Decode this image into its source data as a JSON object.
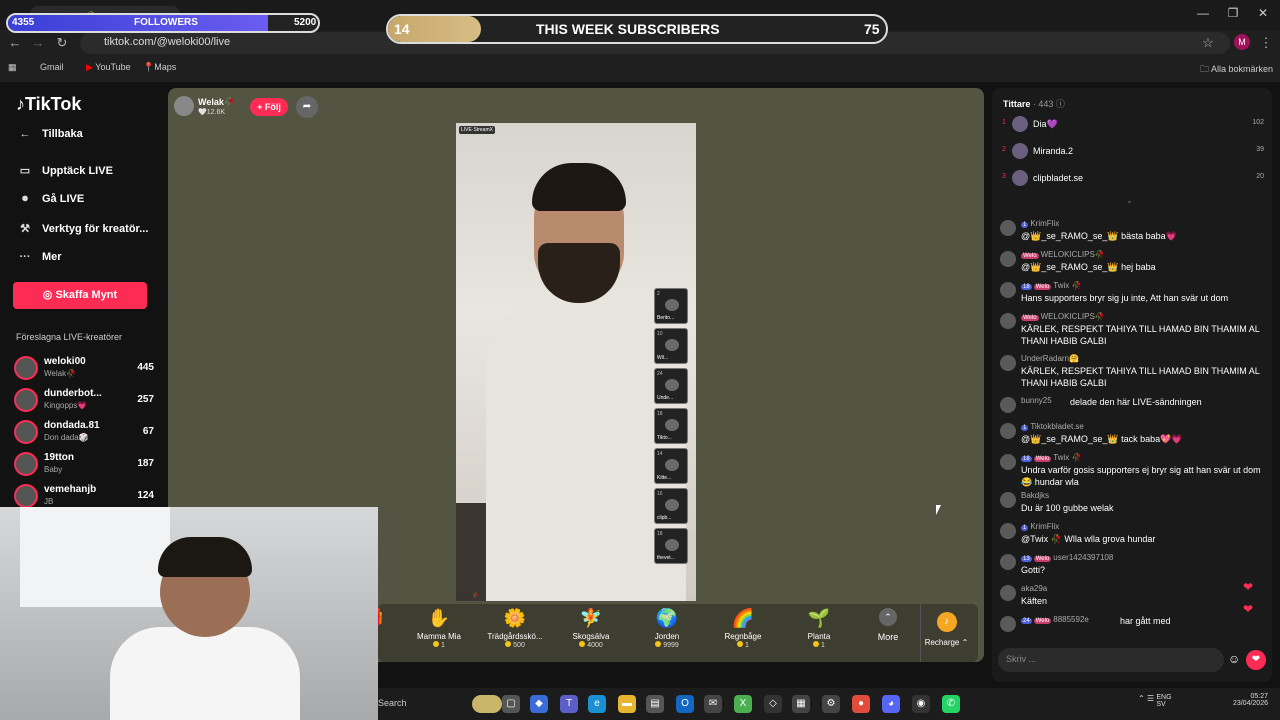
{
  "browser": {
    "tab_title": "Welak🥀 (@weloki00) är LIVE",
    "url": "tiktok.com/@weloki00/live",
    "bookmarks": [
      "Gmail",
      "YouTube",
      "Maps"
    ],
    "all_bookmarks": "Alla bokmärken",
    "profile_initial": "M"
  },
  "overlay": {
    "followers": {
      "current": "4355",
      "label": "FOLLOWERS",
      "goal": "5200",
      "progress": 0.84
    },
    "subscribers": {
      "current": "14",
      "label": "THIS WEEK SUBSCRIBERS",
      "goal": "75",
      "progress": 0.187
    }
  },
  "sidebar": {
    "logo": "TikTok",
    "back": "Tillbaka",
    "nav": [
      "Upptäck LIVE",
      "Gå LIVE",
      "Verktyg för kreatör...",
      "Mer"
    ],
    "coin_button": "Skaffa Mynt",
    "suggested_title": "Föreslagna LIVE-kreatörer",
    "suggested": [
      {
        "name": "weloki00",
        "sub": "Welak🥀",
        "count": "445"
      },
      {
        "name": "dunderbot...",
        "sub": "Kingopps💗",
        "count": "257"
      },
      {
        "name": "dondada.81",
        "sub": "Don dada🎲",
        "count": "67"
      },
      {
        "name": "19tton",
        "sub": "Baby",
        "count": "187"
      },
      {
        "name": "vemehanjb",
        "sub": "JB",
        "count": "124"
      }
    ]
  },
  "stream": {
    "host_name": "Welak🥀",
    "host_likes": "🤍12.6K",
    "follow_label": "+ Följ",
    "video_tag": "LIVE·StreamX",
    "video_name": "Welak🥀",
    "guests": [
      {
        "n": "2",
        "l": "Berito..."
      },
      {
        "n": "10",
        "l": "Wil..."
      },
      {
        "n": "24",
        "l": "Unde..."
      },
      {
        "n": "18",
        "l": "Tikto..."
      },
      {
        "n": "14",
        "l": "Kitte..."
      },
      {
        "n": "16",
        "l": "clipb..."
      },
      {
        "n": "18",
        "l": "thevet..."
      }
    ],
    "gifts": [
      {
        "name": "...s",
        "cost": "",
        "icon": "gift-icon"
      },
      {
        "name": "Mamma Mia",
        "cost": "1",
        "icon": "hand-icon"
      },
      {
        "name": "Trädgårdsskö...",
        "cost": "500",
        "icon": "flower-icon"
      },
      {
        "name": "Skogsälva",
        "cost": "4000",
        "icon": "fairy-icon"
      },
      {
        "name": "Jorden",
        "cost": "9999",
        "icon": "earth-icon"
      },
      {
        "name": "Regnbåge",
        "cost": "1",
        "icon": "rainbow-icon"
      },
      {
        "name": "Planta",
        "cost": "1",
        "icon": "plant-icon"
      }
    ],
    "more_label": "More",
    "recharge_label": "Recharge ⌃"
  },
  "chat": {
    "viewers_label": "Tittare",
    "viewers_count": "· 443",
    "top_viewers": [
      {
        "rank": "1",
        "name": "Dia💜",
        "score": "102"
      },
      {
        "rank": "2",
        "name": "Miranda.2",
        "score": "39"
      },
      {
        "rank": "3",
        "name": "clipbladet.se",
        "score": "20"
      }
    ],
    "messages": [
      {
        "badges": "1",
        "fan": "",
        "user": "KrimFlix",
        "text": "@👑_se_RAMO_se_👑 bästa baba💗"
      },
      {
        "badges": "",
        "fan": "Welo",
        "user": "WELOKICLIPS🥀",
        "text": "@👑_se_RAMO_se_👑 hej baba"
      },
      {
        "badges": "18",
        "fan": "Welo",
        "user": "Twix 🥀",
        "text": "Hans supporters bryr sig ju inte, Att han svär ut dom"
      },
      {
        "badges": "",
        "fan": "Welo",
        "user": "WELOKICLIPS🥀",
        "text": "KÄRLEK, RESPEKT TAHIYA TILL HAMAD BIN THAMIM AL THANI HABIB GALBI"
      },
      {
        "badges": "",
        "fan": "",
        "user": "UnderRadarn🤗",
        "text": "KÄRLEK, RESPEKT TAHIYA TILL HAMAD BIN THAMIM AL THANI HABIB GALBI"
      },
      {
        "badges": "",
        "fan": "",
        "user": "bunny25",
        "text": "delade den här LIVE-sändningen"
      },
      {
        "badges": "1",
        "fan": "",
        "user": "Tiktokbladet.se",
        "text": "@👑_se_RAMO_se_👑 tack baba💖💗"
      },
      {
        "badges": "18",
        "fan": "Welo",
        "user": "Twix 🥀",
        "text": "Undra varför gosis supporters ej bryr sig att han svär ut dom😂 hundar wla"
      },
      {
        "badges": "",
        "fan": "",
        "user": "Bakdjks",
        "text": "Du är 100 gubbe welak"
      },
      {
        "badges": "1",
        "fan": "",
        "user": "KrimFlix",
        "text": "@Twix 🥀 Wlla wlla grova hundar"
      },
      {
        "badges": "13",
        "fan": "Welo",
        "user": "user1424397108",
        "text": "Gotti?"
      },
      {
        "badges": "",
        "fan": "",
        "user": "aka29a",
        "text": "Käften"
      },
      {
        "badges": "24",
        "fan": "Welo",
        "user": "8885592e",
        "text": "har gått med"
      }
    ],
    "input_placeholder": "Skriv ..."
  },
  "taskbar": {
    "search": "Search",
    "lang": "ENG\nSV",
    "time": "05:27",
    "date": "23/04/2026"
  }
}
